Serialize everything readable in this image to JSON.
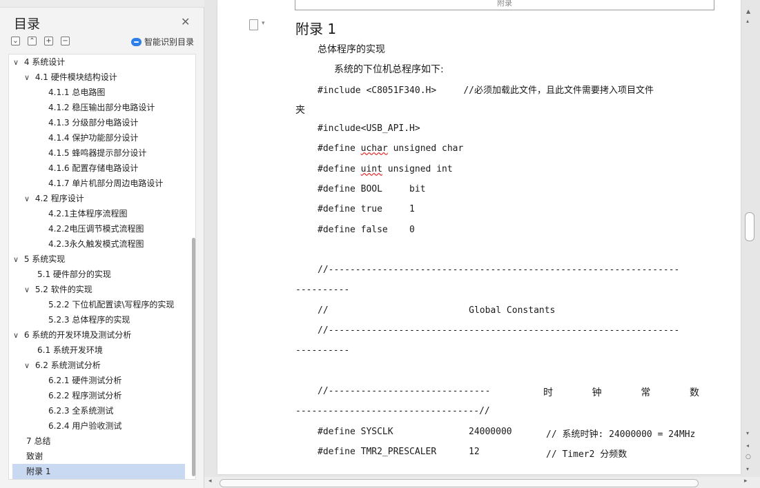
{
  "toc": {
    "title": "目录",
    "smart_label": "智能识别目录",
    "items": [
      {
        "chev": "∨",
        "label": "4   系统设计"
      },
      {
        "chev": "∨",
        "label": "4.1   硬件模块结构设计"
      },
      {
        "chev": "",
        "label": "4.1.1   总电路图"
      },
      {
        "chev": "",
        "label": "4.1.2   稳压输出部分电路设计"
      },
      {
        "chev": "",
        "label": "4.1.3  分级部分电路设计"
      },
      {
        "chev": "",
        "label": "4.1.4   保护功能部分设计"
      },
      {
        "chev": "",
        "label": "4.1.5   蜂鸣器提示部分设计"
      },
      {
        "chev": "",
        "label": "4.1.6   配置存储电路设计"
      },
      {
        "chev": "",
        "label": "4.1.7   单片机部分周边电路设计"
      },
      {
        "chev": "∨",
        "label": "4.2   程序设计"
      },
      {
        "chev": "",
        "label": "4.2.1主体程序流程图"
      },
      {
        "chev": "",
        "label": "4.2.2电压调节模式流程图"
      },
      {
        "chev": "",
        "label": "4.2.3永久触发模式流程图"
      },
      {
        "chev": "∨",
        "label": "5   系统实现"
      },
      {
        "chev": "",
        "label": "5.1   硬件部分的实现"
      },
      {
        "chev": "∨",
        "label": "5.2   软件的实现"
      },
      {
        "chev": "",
        "label": "5.2.2   下位机配置读\\写程序的实现"
      },
      {
        "chev": "",
        "label": "5.2.3   总体程序的实现"
      },
      {
        "chev": "∨",
        "label": "6   系统的开发环境及测试分析"
      },
      {
        "chev": "",
        "label": "6.1   系统开发环境"
      },
      {
        "chev": "∨",
        "label": "6.2   系统测试分析"
      },
      {
        "chev": "",
        "label": "6.2.1   硬件测试分析"
      },
      {
        "chev": "",
        "label": "6.2.2   程序测试分析"
      },
      {
        "chev": "",
        "label": "6.2.3   全系统测试"
      },
      {
        "chev": "",
        "label": "6.2.4   用户验收测试"
      },
      {
        "chev": "",
        "label": "7   总结"
      },
      {
        "chev": "",
        "label": "致谢"
      },
      {
        "chev": "",
        "label": "附录 1"
      }
    ]
  },
  "doc": {
    "header_label": "附录",
    "heading": "附录 1",
    "para1": "总体程序的实现",
    "para2": "系统的下位机总程序如下:",
    "include1": "#include <C8051F340.H>     //必须加载此文件，且此文件需要拷入项目文件",
    "include1_wrap": "夹",
    "include2": "#include<USB_API.H>",
    "def_uchar_pre": "#define ",
    "def_uchar_word": "uchar",
    "def_uchar_post": " unsigned char",
    "def_uint_pre": "#define ",
    "def_uint_word": "uint",
    "def_uint_post": " unsigned int",
    "def_bool": "#define BOOL     bit",
    "def_true": "#define true     1",
    "def_false": "#define false    0",
    "sep1": "//-----------------------------------------------------------------",
    "sep1_wrap": "----------",
    "global_comment": "//                          Global Constants",
    "sep2": "//-----------------------------------------------------------------",
    "sep2_wrap": "----------",
    "clk_prefix": "//------------------------------",
    "clk_words": [
      "时",
      "钟",
      "常",
      "数"
    ],
    "clk_wrap": "----------------------------------//",
    "sysclk_def": "#define SYSCLK",
    "sysclk_val": "24000000",
    "sysclk_comment": "// 系统时钟: 24000000 = 24MHz",
    "tmr2_def": "#define TMR2_PRESCALER",
    "tmr2_val": "12",
    "tmr2_comment": "// Timer2 分频数"
  }
}
